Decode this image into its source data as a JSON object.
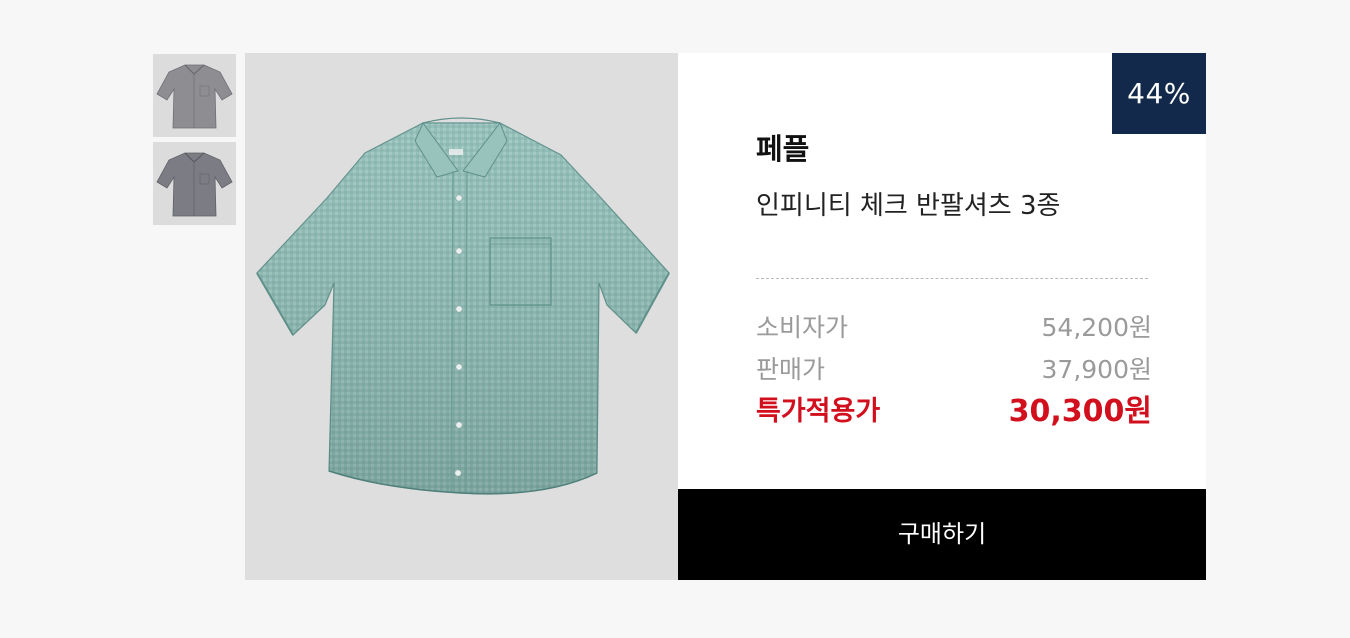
{
  "thumbnails": [
    {
      "alt": "thumbnail-1"
    },
    {
      "alt": "thumbnail-2"
    }
  ],
  "product": {
    "brand": "페플",
    "name": "인피니티 체크 반팔셔츠 3종",
    "discount_badge": "44%",
    "shirt_color": "#8cbab3"
  },
  "prices": {
    "consumer_label": "소비자가",
    "consumer_value": "54,200원",
    "sale_label": "판매가",
    "sale_value": "37,900원",
    "special_label": "특가적용가",
    "special_value": "30,300원"
  },
  "buy_button": {
    "label": "구매하기"
  },
  "colors": {
    "accent_red": "#d20f1c",
    "badge_navy": "#13294b",
    "button_black": "#000000"
  }
}
